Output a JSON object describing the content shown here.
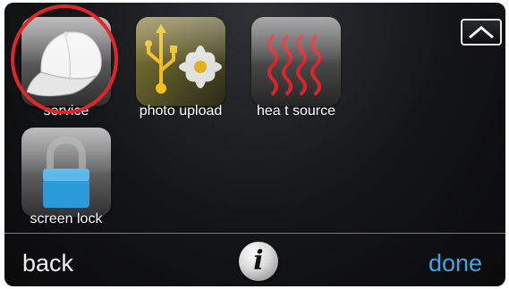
{
  "tiles": [
    {
      "label": "service",
      "icon": "baseball-cap-icon"
    },
    {
      "label": "photo upload",
      "icon": "usb-photo-icon"
    },
    {
      "label": "hea t source",
      "icon": "heat-waves-icon"
    },
    {
      "label": "screen lock",
      "icon": "padlock-icon"
    }
  ],
  "nav": {
    "up_icon": "chevron-up-icon"
  },
  "footer": {
    "back": "back",
    "info": "i",
    "done": "done"
  },
  "colors": {
    "done": "#3aa7e6",
    "highlight_ring": "#e0252b",
    "heat_red": "#d8252c",
    "lock_blue": "#2b9ad8"
  }
}
